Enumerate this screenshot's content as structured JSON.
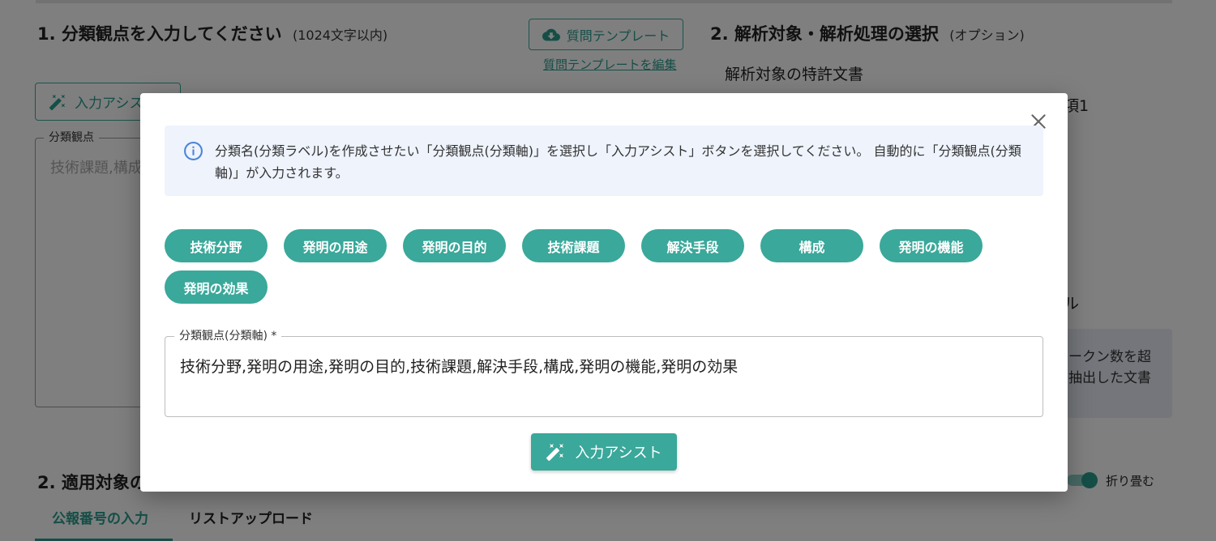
{
  "background": {
    "section1": {
      "number": "1.",
      "title": "分類観点を入力してください",
      "note": "(1024文字以内)"
    },
    "template_button": {
      "label": "質問テンプレート",
      "icon": "cloud-download-icon"
    },
    "template_edit_link": "質問テンプレートを編集",
    "section2": {
      "number": "2.",
      "title": "解析対象・解析処理の選択",
      "note": "(オプション)"
    },
    "target_label": "解析対象の特許文書",
    "right_fragment_1": "項1",
    "right_fragment_2": "ル",
    "assist_button_label": "入力アシスト",
    "viewpoint_legend": "分類観点",
    "viewpoint_placeholder": "技術課題,構成",
    "right_info_line1": "ークン数を超",
    "right_info_line2": "抽出した文書",
    "section3": {
      "number": "2.",
      "title": "適用対象の"
    },
    "toggle_label": "折り畳む",
    "tabs": [
      {
        "label": "公報番号の入力"
      },
      {
        "label": "リストアップロード"
      }
    ]
  },
  "modal": {
    "info_text": "分類名(分類ラベル)を作成させたい「分類観点(分類軸)」を選択し「入力アシスト」ボタンを選択してください。 自動的に「分類観点(分類軸)」が入力されます。",
    "chips": [
      {
        "label": "技術分野"
      },
      {
        "label": "発明の用途"
      },
      {
        "label": "発明の目的"
      },
      {
        "label": "技術課題"
      },
      {
        "label": "解決手段"
      },
      {
        "label": "構成"
      },
      {
        "label": "発明の機能"
      },
      {
        "label": "発明の効果"
      }
    ],
    "field": {
      "label": "分類観点(分類軸) *",
      "value": "技術分野,発明の用途,発明の目的,技術課題,解決手段,構成,発明の機能,発明の効果"
    },
    "assist_button": {
      "label": "入力アシスト",
      "icon": "magic-wand-icon"
    }
  },
  "colors": {
    "accent": "#3aa89a",
    "info_bg": "#eef3fc",
    "overlay": "rgba(0,0,0,0.5)"
  }
}
